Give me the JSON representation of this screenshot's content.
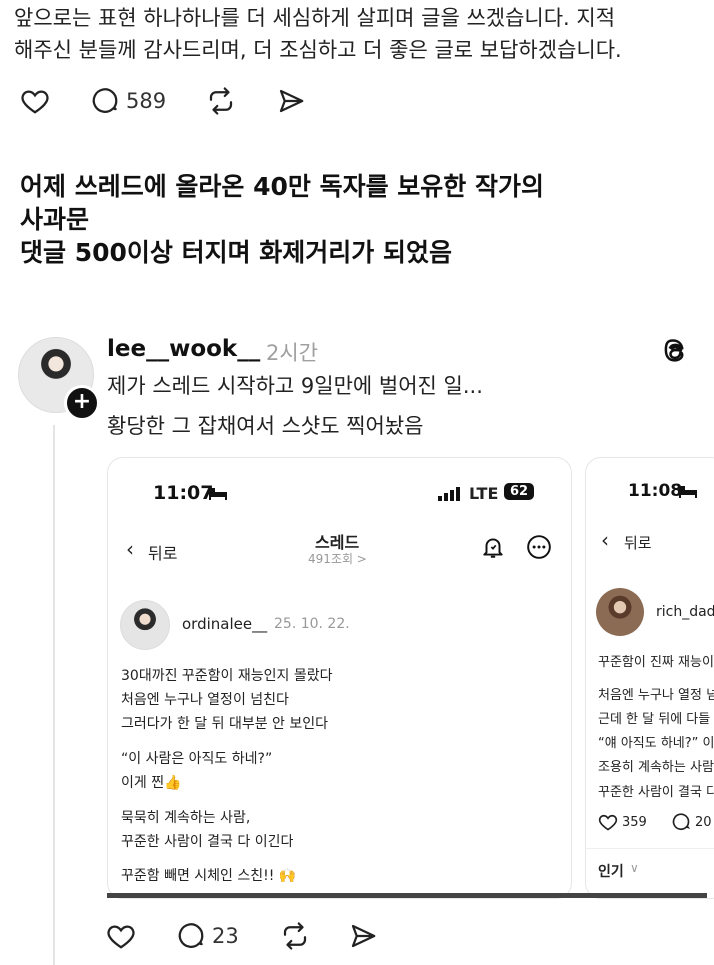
{
  "top_text": {
    "lines": [
      "앞으로는 표현 하나하나를 더 세심하게 살피며 글을 쓰겠습니다. 지적",
      "해주신 분들께 감사드리며, 더 조심하고 더 좋은 글로 보답하겠습니다."
    ]
  },
  "top_actions": {
    "reply_count": "589"
  },
  "headline": {
    "lines": [
      "어제 쓰레드에 올라온 40만 독자를 보유한 작가의",
      "사과문",
      "댓글 500이상 터지며 화제거리가 되었음"
    ]
  },
  "post": {
    "username": "lee__wook__",
    "time": "2시간",
    "lines": [
      "제가 스레드 시작하고 9일만에 벌어진 일...",
      "황당한 그 잡채여서 스샷도 찍어놨음"
    ],
    "actions": {
      "reply_count": "23"
    }
  },
  "shot1": {
    "status_time": "11:07",
    "network": "LTE",
    "battery": "62",
    "back_label": "뒤로",
    "title": "스레드",
    "views": "491조회 >",
    "author": "ordinalee__",
    "date": "25. 10. 22.",
    "body": [
      "30대까진 꾸준함이 재능인지 몰랐다",
      "처음엔 누구나 열정이 넘친다",
      "그러다가 한 달 뒤 대부분 안 보인다",
      "“이 사람은 아직도 하네?”",
      "이게 찐👍",
      "묵묵히 계속하는 사람,",
      "꾸준한 사람이 결국 다 이긴다",
      "꾸준함 빼면 시체인 스친!! 🙌"
    ]
  },
  "shot2": {
    "status_time": "11:08",
    "back_label": "뒤로",
    "author": "rich_dad",
    "body": [
      "꾸준함이 진짜 재능이",
      "처음엔 누구나 열정 넘",
      "근데 한 달 뒤에 다들",
      "“얘 아직도 하네?” 이",
      "조용히 계속하는 사람",
      "꾸준한 사람이 결국 다"
    ],
    "like_count": "359",
    "reply_count": "20",
    "sort_label": "인기"
  }
}
